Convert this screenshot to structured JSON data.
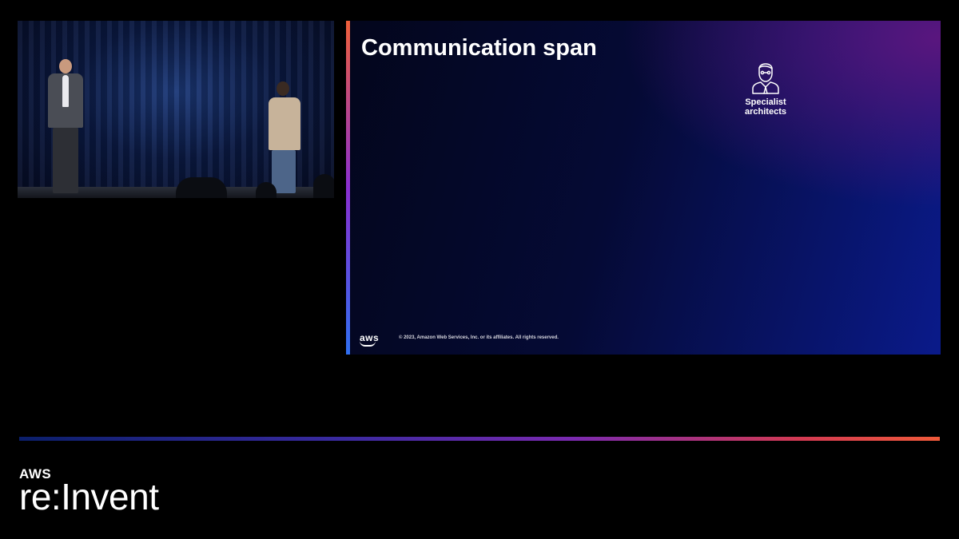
{
  "slide": {
    "title": "Communication span",
    "persona": {
      "icon": "specialist-architect-icon",
      "label": "Specialist architects"
    },
    "footer": {
      "logo": "aws",
      "copyright": "© 2023, Amazon Web Services, Inc. or its affiliates. All rights reserved."
    }
  },
  "branding": {
    "aws": "AWS",
    "event": "re:Invent"
  },
  "colors": {
    "background": "#000000",
    "slide_accent_top": "#f0603a",
    "slide_accent_bottom": "#2f6ff0",
    "slide_text": "#ffffff"
  }
}
